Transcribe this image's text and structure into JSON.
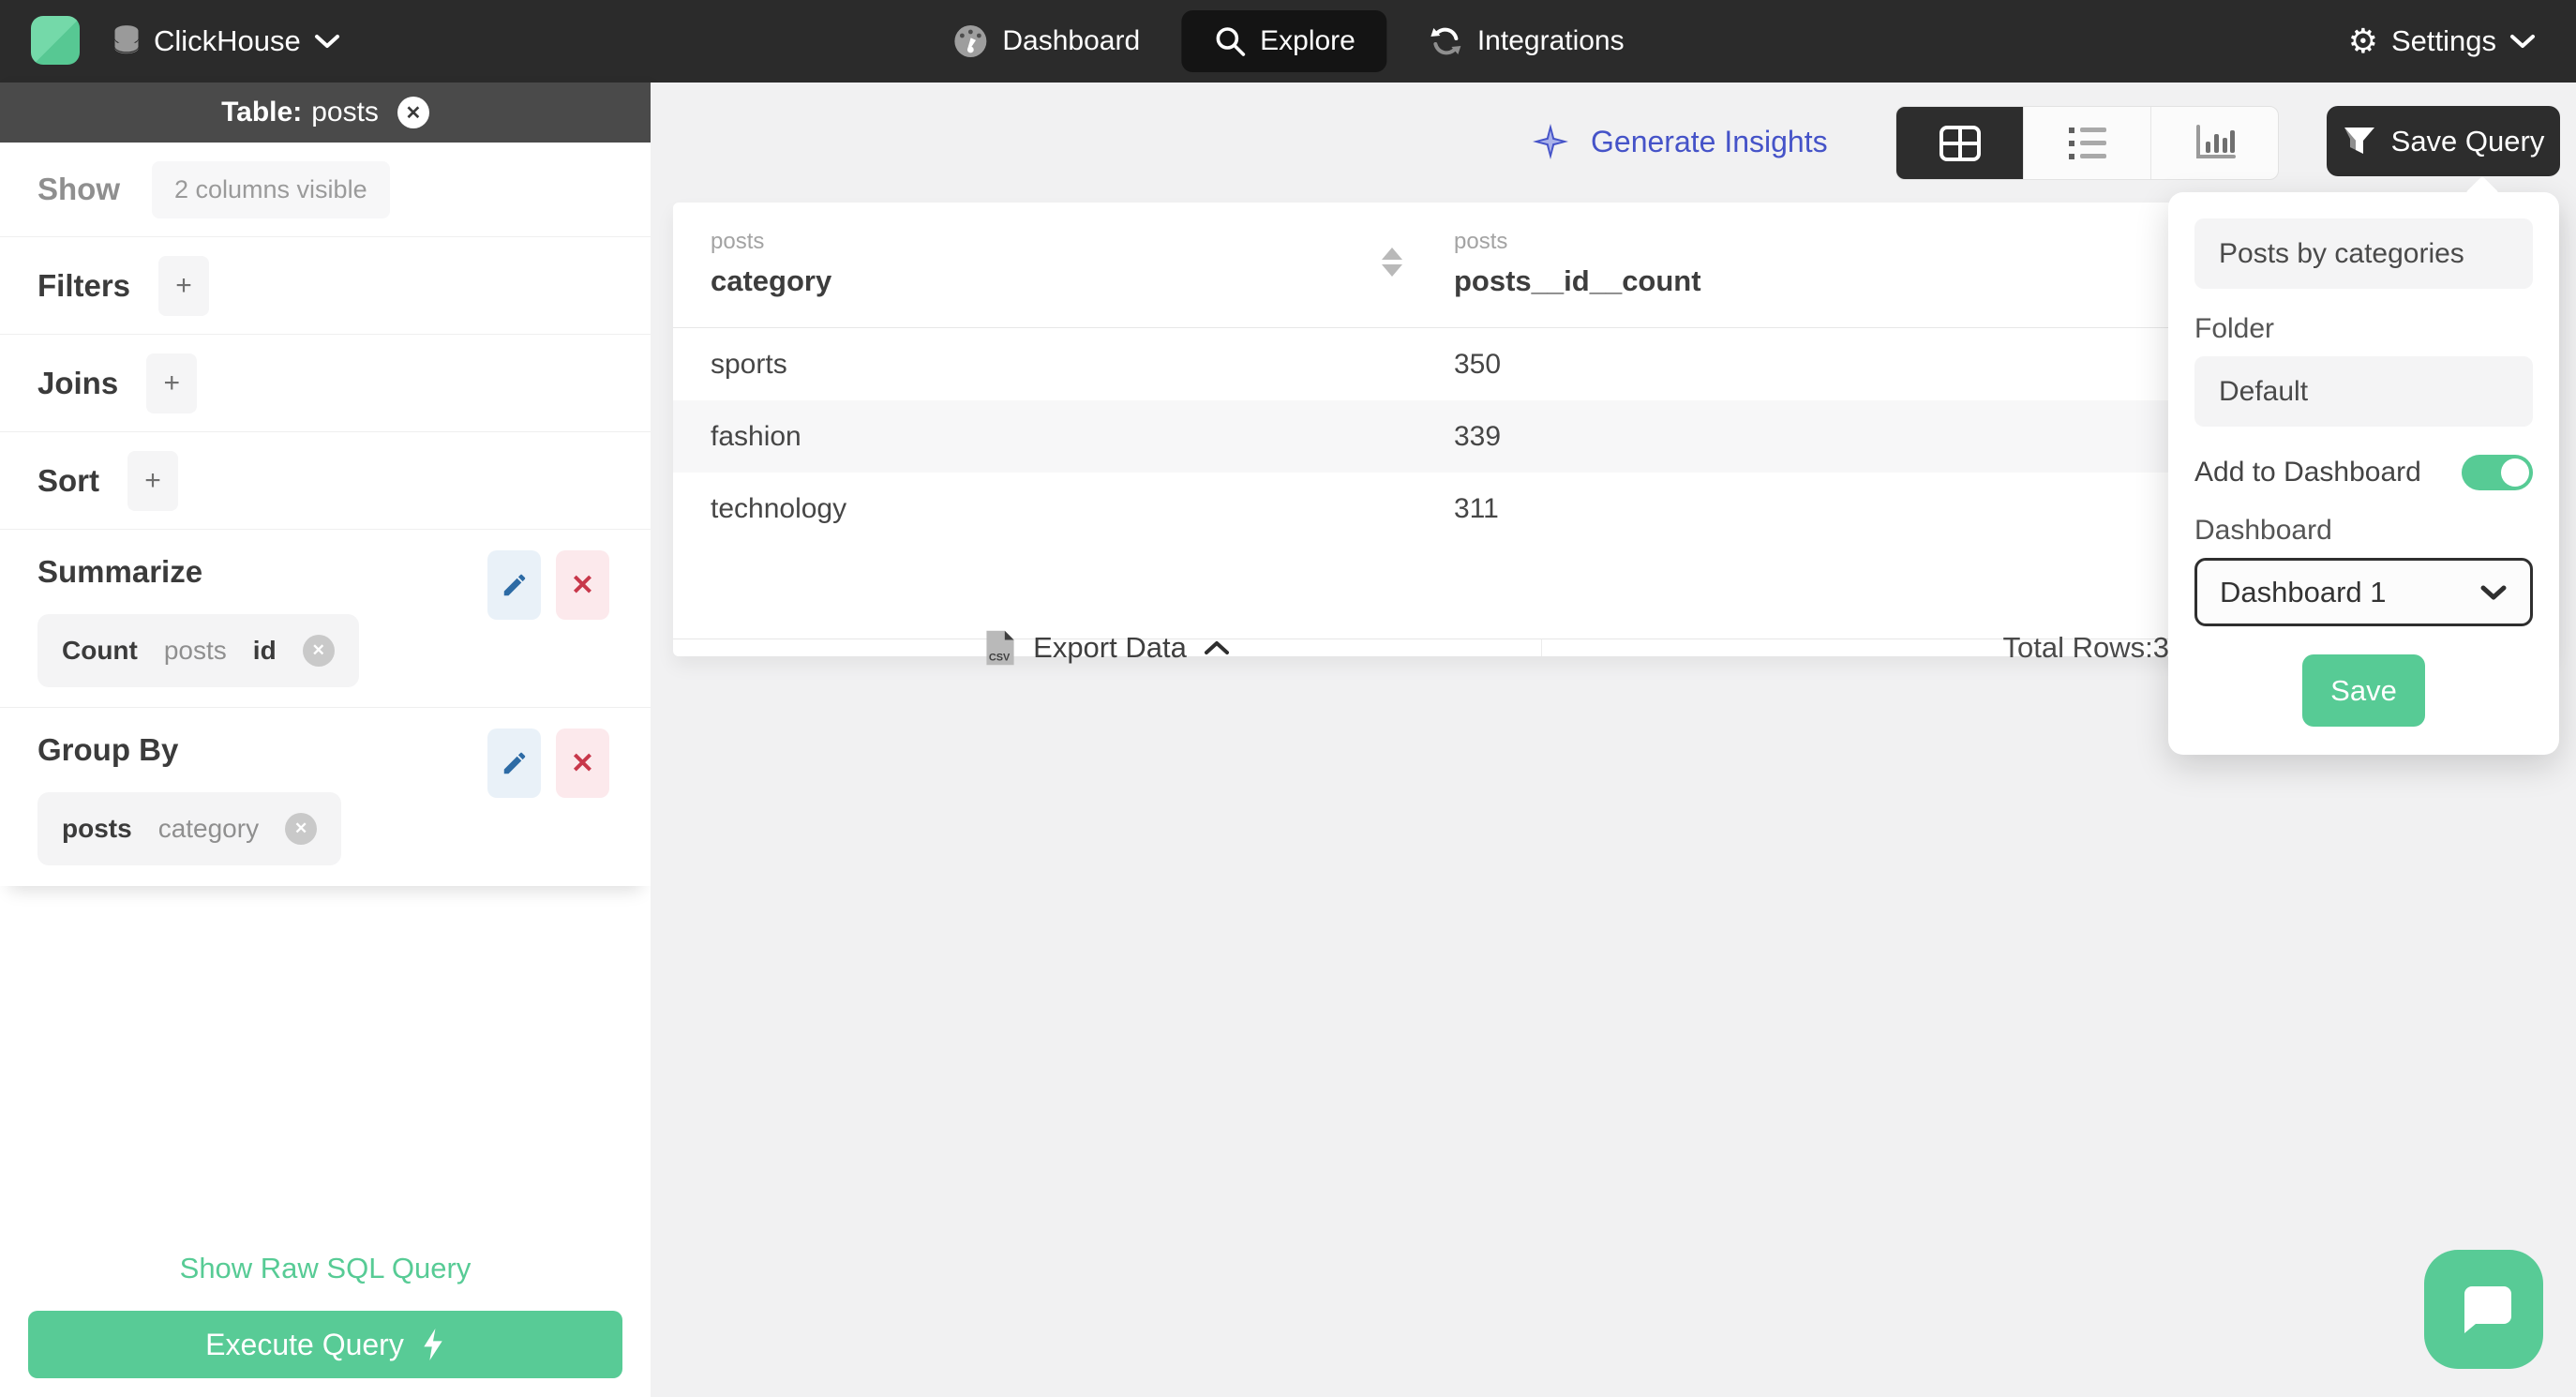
{
  "topbar": {
    "datasource": "ClickHouse",
    "nav": [
      {
        "label": "Dashboard"
      },
      {
        "label": "Explore"
      },
      {
        "label": "Integrations"
      }
    ],
    "settings_label": "Settings"
  },
  "sidebar": {
    "table_label": "Table:",
    "table_name": "posts",
    "show_label": "Show",
    "show_value": "2 columns visible",
    "filters_label": "Filters",
    "joins_label": "Joins",
    "sort_label": "Sort",
    "add_button": "+",
    "summarize": {
      "label": "Summarize",
      "chip": {
        "agg": "Count",
        "table": "posts",
        "column": "id"
      }
    },
    "group_by": {
      "label": "Group By",
      "chip": {
        "table": "posts",
        "column": "category"
      }
    },
    "raw_sql_link": "Show Raw SQL Query",
    "execute_button": "Execute Query"
  },
  "main": {
    "insights_label": "Generate Insights",
    "save_query_label": "Save Query"
  },
  "table": {
    "columns": [
      {
        "group": "posts",
        "name": "category"
      },
      {
        "group": "posts",
        "name": "posts__id__count"
      }
    ],
    "rows": [
      {
        "category": "sports",
        "count": "350"
      },
      {
        "category": "fashion",
        "count": "339"
      },
      {
        "category": "technology",
        "count": "311"
      }
    ],
    "export_label": "Export Data",
    "total_label": "Total Rows:",
    "total_value": "3"
  },
  "popover": {
    "name_value": "Posts by categories",
    "folder_label": "Folder",
    "folder_value": "Default",
    "add_to_dashboard_label": "Add to Dashboard",
    "dashboard_label": "Dashboard",
    "dashboard_value": "Dashboard 1",
    "save_label": "Save"
  },
  "colors": {
    "accent_green": "#57cb95",
    "accent_indigo": "#4553c8",
    "dark": "#2d2d2d"
  }
}
